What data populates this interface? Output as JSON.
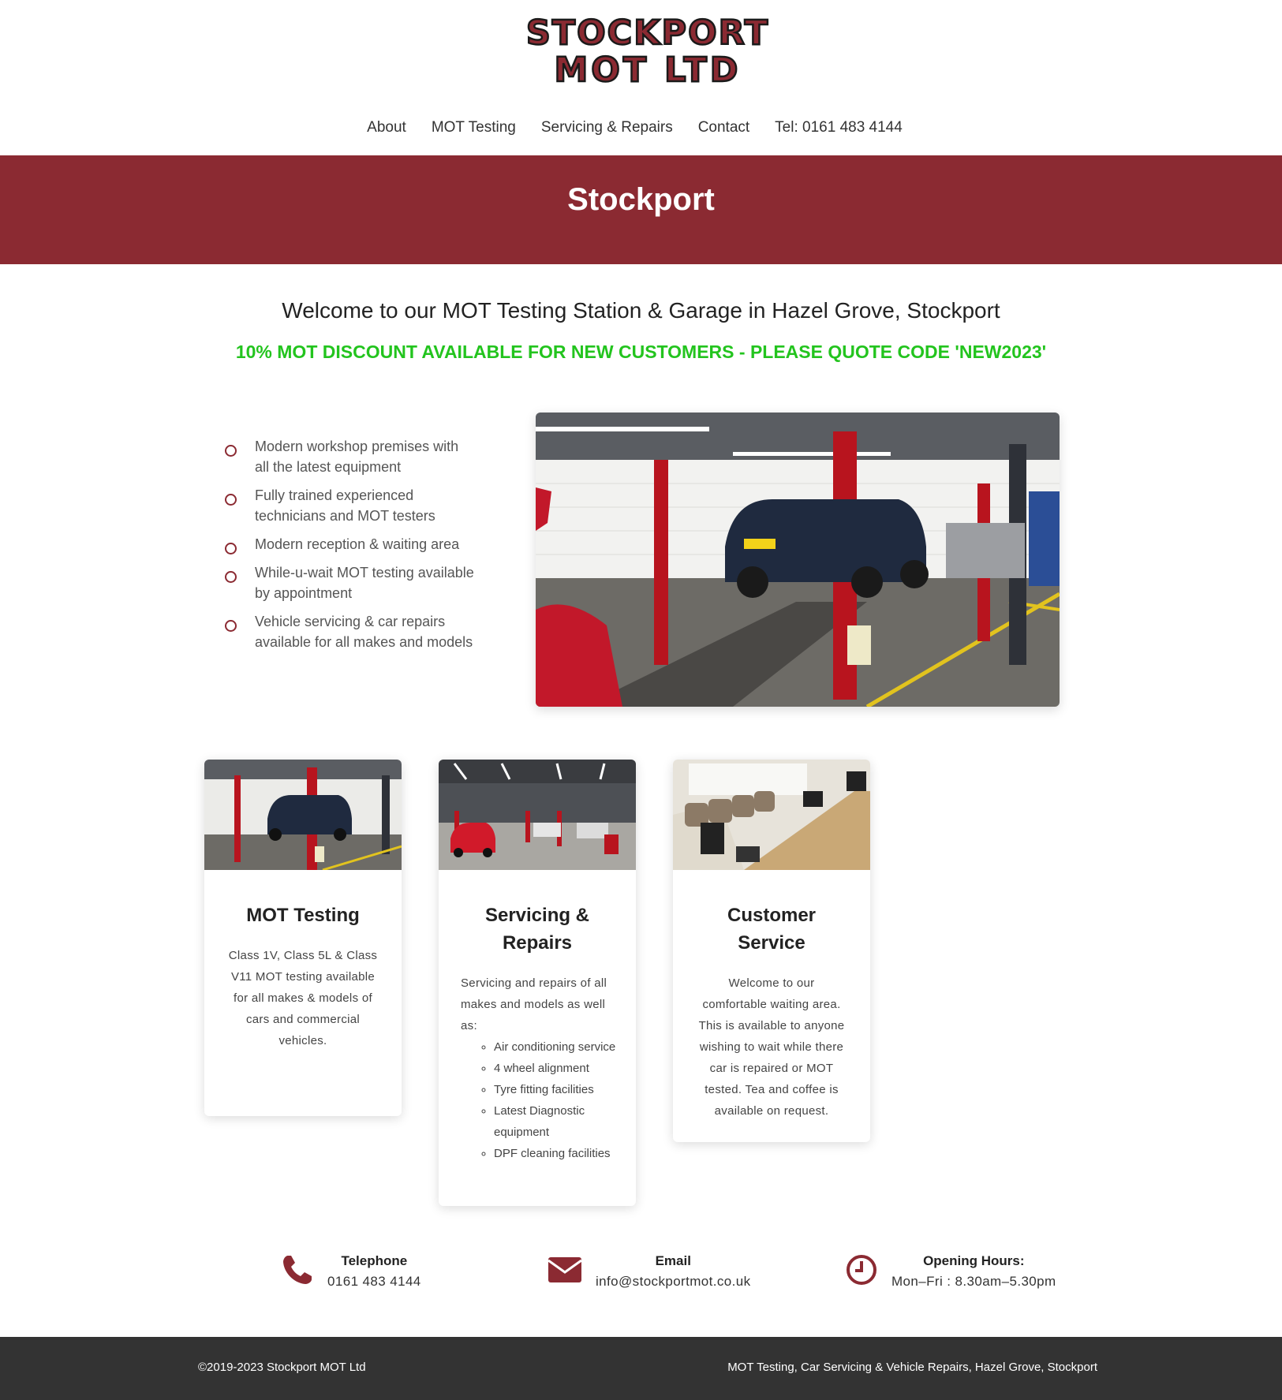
{
  "brand": {
    "logo_line1": "STOCKPORT",
    "logo_line2": "MOT LTD",
    "color": "#8b2a32"
  },
  "nav": {
    "items": [
      "About",
      "MOT Testing",
      "Servicing & Repairs",
      "Contact",
      "Tel: 0161 483 4144"
    ]
  },
  "banner": {
    "title": "Stockport"
  },
  "welcome": {
    "heading": "Welcome to our MOT Testing Station & Garage in Hazel Grove, Stockport",
    "promo": "10% MOT DISCOUNT AVAILABLE FOR NEW CUSTOMERS - PLEASE QUOTE CODE 'NEW2023'",
    "promo_color": "#23c41e"
  },
  "features": [
    "Modern workshop premises with all the latest equipment",
    "Fully trained experienced technicians and MOT testers",
    "Modern reception & waiting area",
    "While-u-wait MOT testing available by appointment",
    "Vehicle servicing & car repairs available for all makes and models"
  ],
  "cards": [
    {
      "title": "MOT Testing",
      "text": "Class 1V, Class 5L & Class V11 MOT testing available for all makes & models of cars and commercial vehicles."
    },
    {
      "title": "Servicing & Repairs",
      "text": "Servicing and repairs of all makes and models as well as:",
      "list": [
        "Air conditioning service",
        "4 wheel alignment",
        "Tyre fitting facilities",
        "Latest Diagnostic equipment",
        "DPF cleaning facilities"
      ]
    },
    {
      "title": "Customer Service",
      "text": "Welcome to our comfortable waiting area. This is available to anyone wishing to wait while there car is repaired or MOT tested. Tea and coffee is available on request."
    }
  ],
  "contact": {
    "telephone": {
      "label": "Telephone",
      "value": "0161 483 4144",
      "icon": "phone-icon"
    },
    "email": {
      "label": "Email",
      "value": "info@stockportmot.co.uk",
      "icon": "envelope-icon"
    },
    "hours": {
      "label": "Opening Hours:",
      "value": "Mon–Fri : 8.30am–5.30pm",
      "icon": "clock-icon"
    }
  },
  "footer": {
    "copyright": "©2019-2023 Stockport MOT Ltd",
    "tagline": "MOT Testing, Car Servicing & Vehicle Repairs, Hazel Grove, Stockport"
  }
}
